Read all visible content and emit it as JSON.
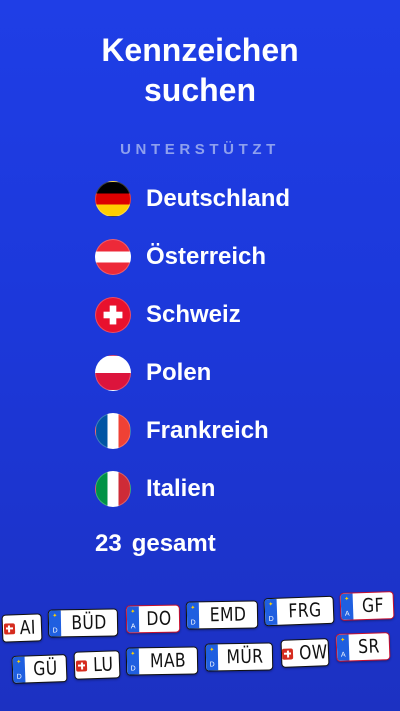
{
  "header": {
    "title_line1": "Kennzeichen",
    "title_line2": "suchen",
    "supported_label": "UNTERSTÜTZT"
  },
  "countries": [
    {
      "name": "Deutschland",
      "flag": "germany-flag"
    },
    {
      "name": "Österreich",
      "flag": "austria-flag"
    },
    {
      "name": "Schweiz",
      "flag": "switzerland-flag"
    },
    {
      "name": "Polen",
      "flag": "poland-flag"
    },
    {
      "name": "Frankreich",
      "flag": "france-flag"
    },
    {
      "name": "Italien",
      "flag": "italy-flag"
    }
  ],
  "total": {
    "count": "23",
    "label": "gesamt"
  },
  "plates_row1": [
    {
      "code": "AI",
      "type": "CH"
    },
    {
      "code": "BÜD",
      "type": "D"
    },
    {
      "code": "DO",
      "type": "A"
    },
    {
      "code": "EMD",
      "type": "D"
    },
    {
      "code": "FRG",
      "type": "D"
    },
    {
      "code": "GF",
      "type": "A"
    }
  ],
  "plates_row2": [
    {
      "code": "GÜ",
      "type": "D"
    },
    {
      "code": "LU",
      "type": "CH"
    },
    {
      "code": "MAB",
      "type": "D"
    },
    {
      "code": "MÜR",
      "type": "D"
    },
    {
      "code": "OW",
      "type": "CH"
    },
    {
      "code": "SR",
      "type": "A"
    }
  ],
  "colors": {
    "background_top": "#1f3ee6",
    "background_bottom": "#1c31c2",
    "subtitle": "#8ea0ee"
  }
}
